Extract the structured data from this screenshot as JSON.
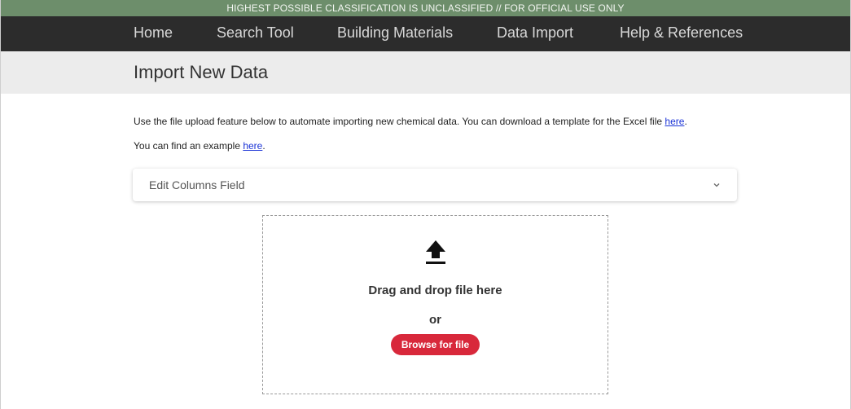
{
  "banner": {
    "text": "HIGHEST POSSIBLE CLASSIFICATION IS UNCLASSIFIED // FOR OFFICIAL USE ONLY",
    "color": "#6d8e6b"
  },
  "nav": {
    "items": [
      {
        "label": "Home"
      },
      {
        "label": "Search Tool"
      },
      {
        "label": "Building Materials"
      },
      {
        "label": "Data Import"
      },
      {
        "label": "Help & References"
      }
    ]
  },
  "page": {
    "title": "Import New Data"
  },
  "intro": {
    "line1": "Use the file upload feature below to automate importing new chemical data. You can download a template for the Excel file ",
    "line1_link": "here",
    "line1_end": ".",
    "line2": "You can find an example ",
    "line2_link": "here",
    "line2_end": "."
  },
  "accordion": {
    "label": "Edit Columns Field",
    "icon": "chevron-down-icon"
  },
  "dropzone": {
    "icon": "upload-icon",
    "drag_text": "Drag and drop file here",
    "or_text": "or",
    "browse_label": "Browse for file",
    "button_color": "#d8283b"
  }
}
